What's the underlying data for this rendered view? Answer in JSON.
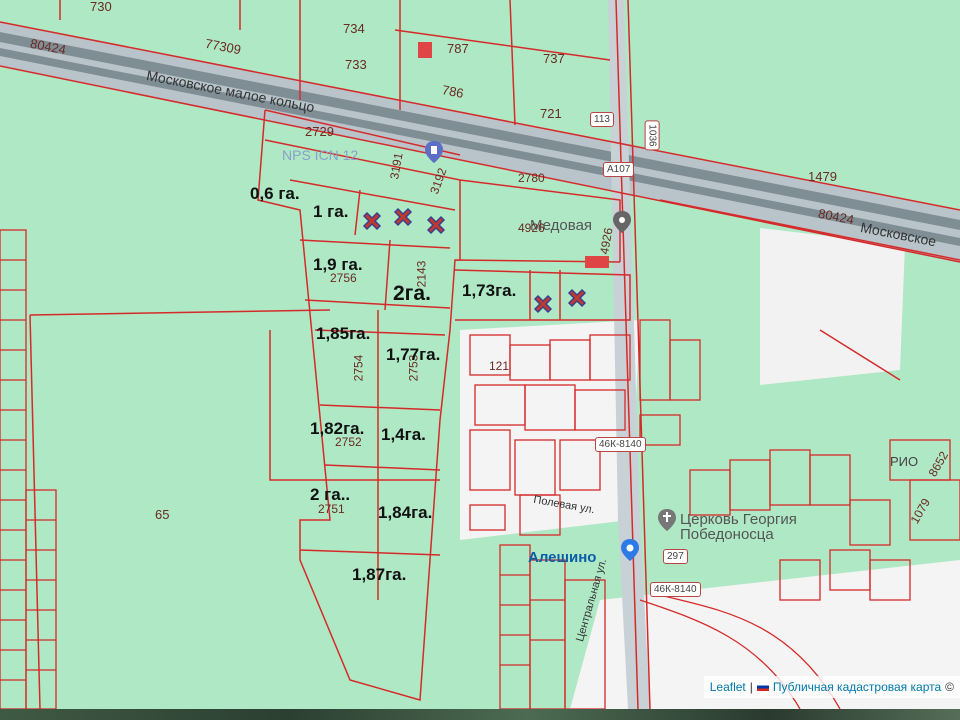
{
  "map": {
    "highway_name": "Московское малое кольцо",
    "highway_name_right": "Московское",
    "road_shields": [
      "А107",
      "113",
      "1036",
      "46К-8140",
      "46К-8140",
      "297"
    ],
    "street_labels": [
      "Полевая ул.",
      "Центральная ул."
    ],
    "places": [
      "Алешино",
      "Церковь Георгия Победоносца",
      "Медовая",
      "РИО",
      "NPS ICN 12"
    ],
    "parcel_numbers": [
      "730",
      "734",
      "787",
      "80424",
      "77309",
      "733",
      "737",
      "786",
      "721",
      "1479",
      "2729",
      "3191",
      "3192",
      "2780",
      "4926",
      "4926",
      "80424",
      "2756",
      "2143",
      "2754",
      "2753",
      "2752",
      "2751",
      "121",
      "65",
      "1079",
      "8652"
    ],
    "lot_areas": [
      "0,6 га.",
      "1 га.",
      "1,9 га.",
      "2га.",
      "1,73га.",
      "1,85га.",
      "1,77га.",
      "1,82га.",
      "1,4га.",
      "2 га..",
      "1,84га.",
      "1,87га."
    ],
    "sold_marker_icon": "cross-marker-icon",
    "colors": {
      "background": "#aee8c5",
      "boundary": "#d62a2a",
      "highway": "#9aa7ad",
      "marker": "#c0392b",
      "marker_outline": "#3b3f8f"
    }
  },
  "attribution": {
    "leaflet": "Leaflet",
    "separator": "|",
    "source": "Публичная кадастровая карта",
    "copyright": "©"
  }
}
